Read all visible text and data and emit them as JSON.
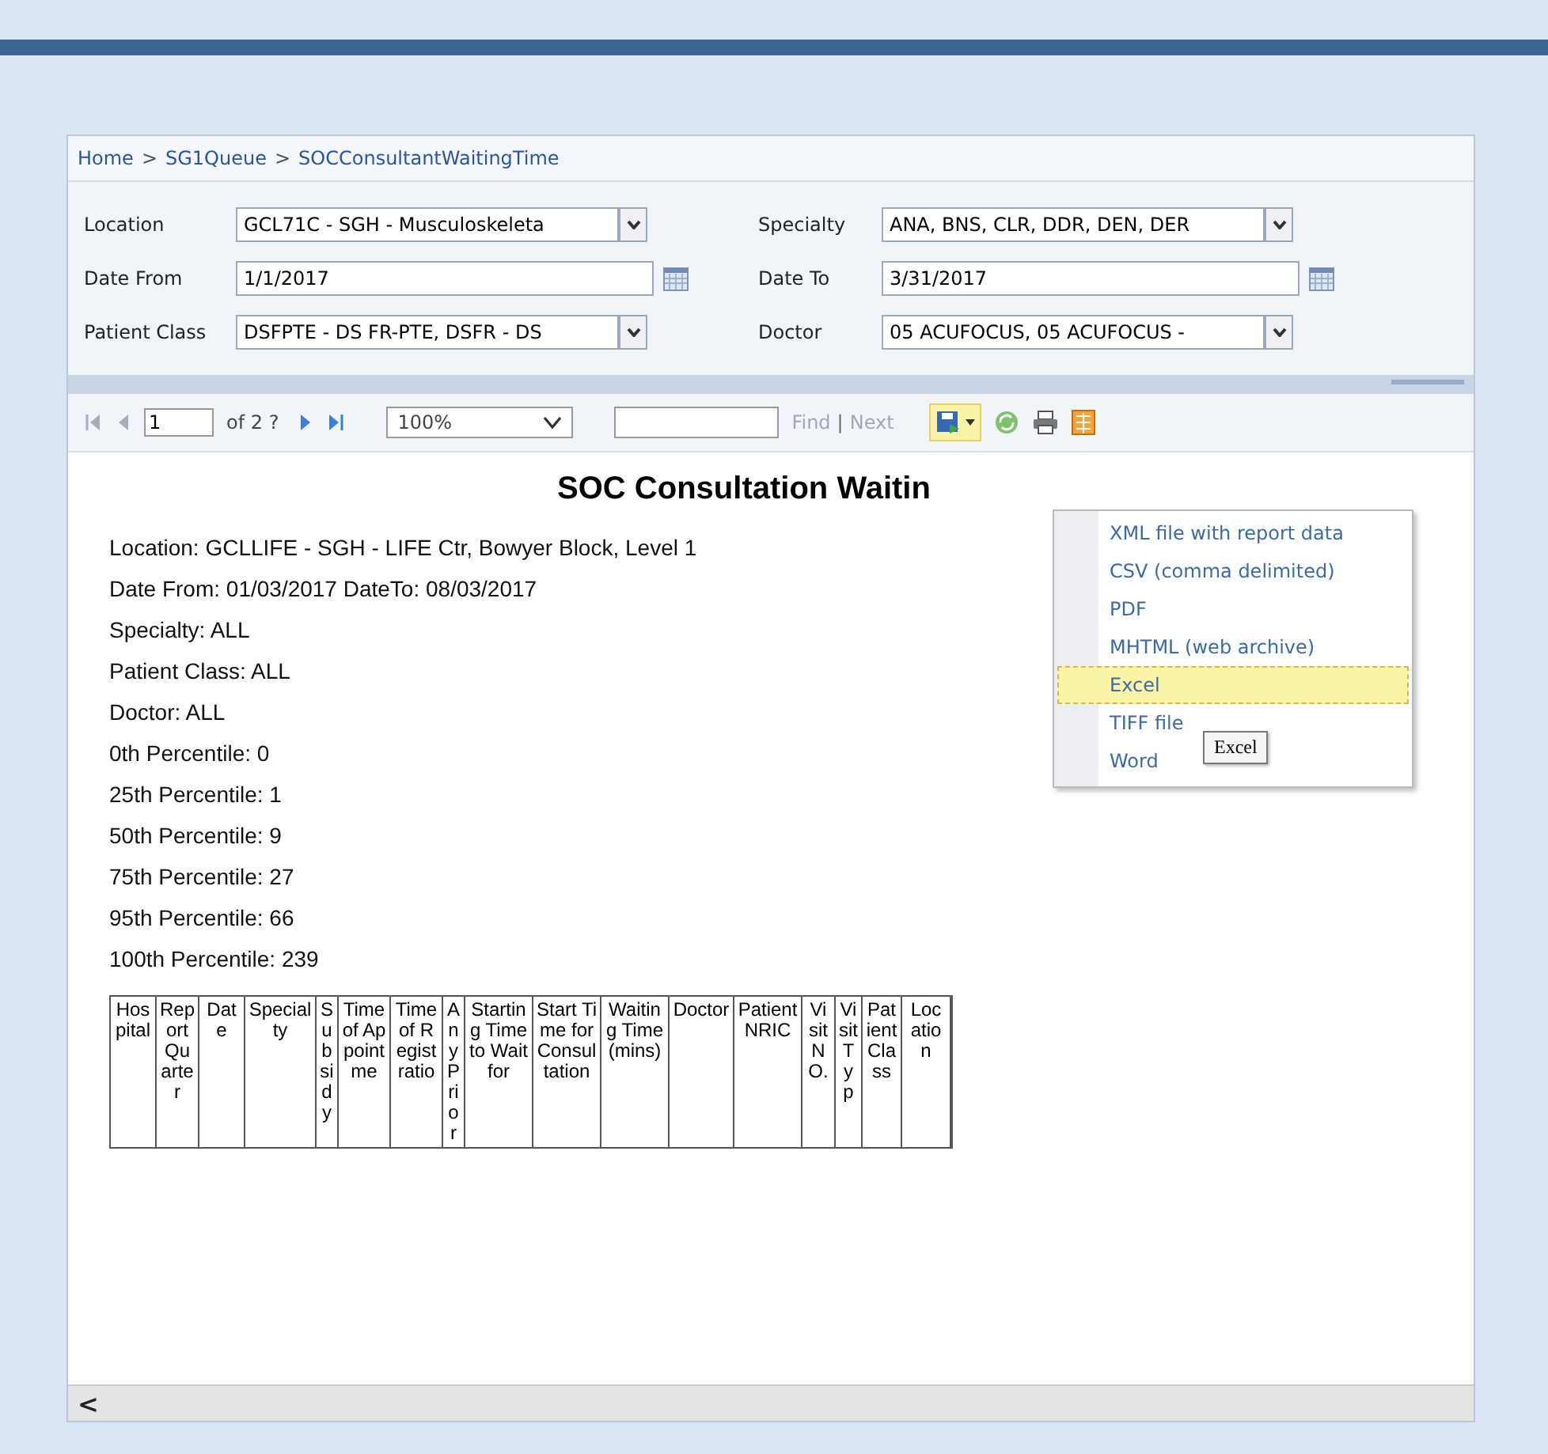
{
  "breadcrumb": [
    {
      "label": "Home"
    },
    {
      "label": "SG1Queue"
    },
    {
      "label": "SOCConsultantWaitingTime"
    }
  ],
  "breadcrumb_separator": ">",
  "parameters": [
    {
      "label": "Location",
      "value": "GCL71C - SGH - Musculoskeleta",
      "kind": "dropdown"
    },
    {
      "label": "Specialty",
      "value": "ANA, BNS, CLR, DDR, DEN, DER",
      "kind": "dropdown"
    },
    {
      "label": "Date From",
      "value": "1/1/2017",
      "kind": "date"
    },
    {
      "label": "Date To",
      "value": "3/31/2017",
      "kind": "date"
    },
    {
      "label": "Patient Class",
      "value": "DSFPTE - DS FR-PTE, DSFR - DS",
      "kind": "dropdown"
    },
    {
      "label": "Doctor",
      "value": "05 ACUFOCUS, 05 ACUFOCUS -",
      "kind": "dropdown"
    }
  ],
  "toolbar": {
    "page": "1",
    "page_count": "of 2 ?",
    "zoom": "100%",
    "find": "Find",
    "separator": "|",
    "next": "Next"
  },
  "export_menu": {
    "items": [
      {
        "label": "XML file with report data",
        "selected": false
      },
      {
        "label": "CSV (comma delimited)",
        "selected": false
      },
      {
        "label": "PDF",
        "selected": false
      },
      {
        "label": "MHTML (web archive)",
        "selected": false
      },
      {
        "label": "Excel",
        "selected": true
      },
      {
        "label": "TIFF file",
        "selected": false
      },
      {
        "label": "Word",
        "selected": false
      }
    ],
    "tooltip": "Excel"
  },
  "report": {
    "title": "SOC Consultation Waitin",
    "lines": [
      "Location: GCLLIFE - SGH - LIFE Ctr, Bowyer Block, Level 1",
      "Date From: 01/03/2017 DateTo: 08/03/2017",
      "Specialty: ALL",
      "Patient Class: ALL",
      "Doctor: ALL",
      "0th Percentile: 0",
      "25th Percentile: 1",
      "50th Percentile: 9",
      "75th Percentile: 27",
      "95th Percentile: 66",
      "100th Percentile: 239"
    ],
    "columns": [
      "Hospital",
      "Report Quarter",
      "Date",
      "Specialty",
      "Subsidy",
      "Time of Appointme",
      "Time of Registratio",
      "AnyPrior",
      "Starting Time to Wait for",
      "Start Time for Consultation",
      "Waiting Time (mins)",
      "Doctor",
      "Patient NRIC",
      "Visit NO.",
      "Visit Typ",
      "Patient Class",
      "Location"
    ]
  },
  "scrollbar_arrow": "<"
}
